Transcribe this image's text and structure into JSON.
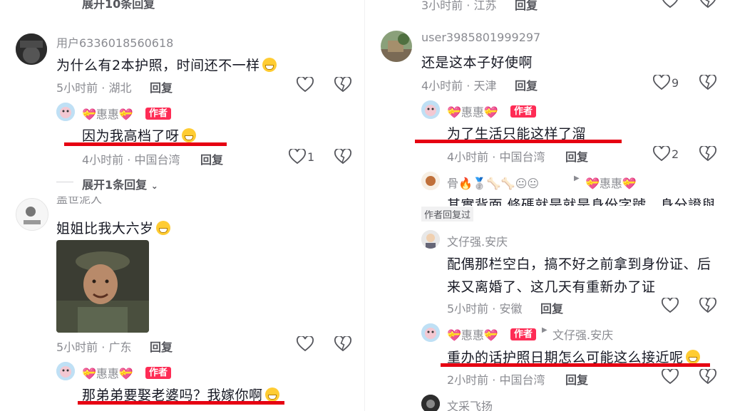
{
  "left": {
    "top_partial": "展开10条回复",
    "c1": {
      "username": "用户6336018560618",
      "text": "为什么有2本护照，时间还不一样",
      "meta": "5小时前 · 湖北",
      "reply": "回复"
    },
    "r1": {
      "username": "💝惠惠💝",
      "badge": "作者",
      "text": "因为我高档了呀",
      "meta": "4小时前 · 中国台湾",
      "reply": "回复",
      "likes": "1"
    },
    "expand": "展开1条回复",
    "c2": {
      "username": "盖世泥人",
      "text": "姐姐比我大六岁",
      "meta": "5小时前 · 广东",
      "reply": "回复"
    },
    "r2": {
      "username": "💝惠惠💝",
      "badge": "作者",
      "text": "那弟弟要娶老婆吗？我嫁你啊"
    }
  },
  "right": {
    "top_partial": "3小时前 · 江苏",
    "top_reply": "回复",
    "c1": {
      "username": "user3985801999297",
      "text": "还是这本子好使啊",
      "meta": "4小时前 · 天津",
      "reply": "回复",
      "likes": "9"
    },
    "r1": {
      "username": "💝惠惠💝",
      "badge": "作者",
      "text": "为了生活只能这样了溜",
      "meta": "4小时前 · 中国台湾",
      "reply": "回复",
      "likes": "2"
    },
    "r2": {
      "username": "骨🔥🥈🦴🦴😐😐",
      "reply_to": "💝惠惠💝",
      "text": "其實背面 條碼就是就是身份字號，身分證與",
      "tag": "作者回复过"
    },
    "c2": {
      "username": "文仔强.安庆",
      "text_line1": "配偶那栏空白，搞不好之前拿到身份证、后",
      "text_line2": "来又离婚了、这几天有重新办了证",
      "meta": "5小时前 · 安徽",
      "reply": "回复"
    },
    "r3": {
      "username": "💝惠惠💝",
      "badge": "作者",
      "reply_to": "文仔强.安庆",
      "text": "重办的话护照日期怎么可能这么接近呢",
      "meta": "2小时前 · 中国台湾",
      "reply": "回复"
    },
    "c3": {
      "username": "文采飞扬"
    }
  },
  "colors": {
    "red_underline": "#e60012",
    "badge": "#fe2c55",
    "meta": "#8a8b91"
  }
}
